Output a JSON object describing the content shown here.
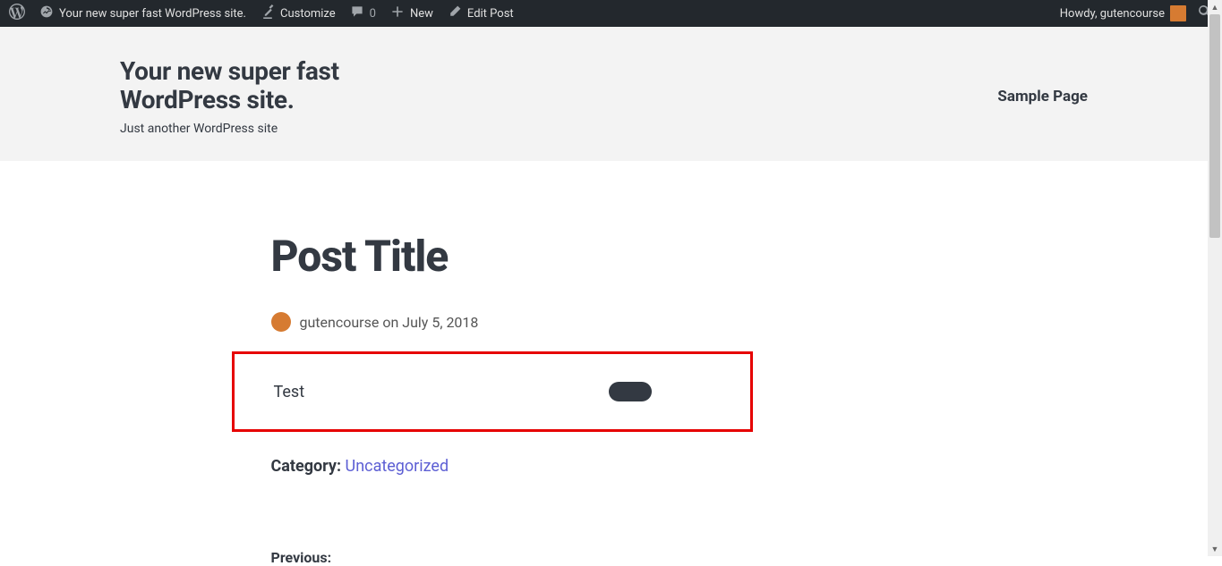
{
  "admin_bar": {
    "site_name": "Your new super fast WordPress site.",
    "customize": "Customize",
    "comments_count": "0",
    "new": "New",
    "edit_post": "Edit Post",
    "howdy": "Howdy, gutencourse"
  },
  "header": {
    "site_title": "Your new super fast WordPress site.",
    "tagline": "Just another WordPress site",
    "nav_item": "Sample Page"
  },
  "post": {
    "title": "Post Title",
    "author": "gutencourse",
    "on": "on",
    "date": "July 5, 2018",
    "content_text": "Test",
    "category_label": "Category:",
    "category_value": "Uncategorized",
    "previous_label": "Previous:"
  }
}
